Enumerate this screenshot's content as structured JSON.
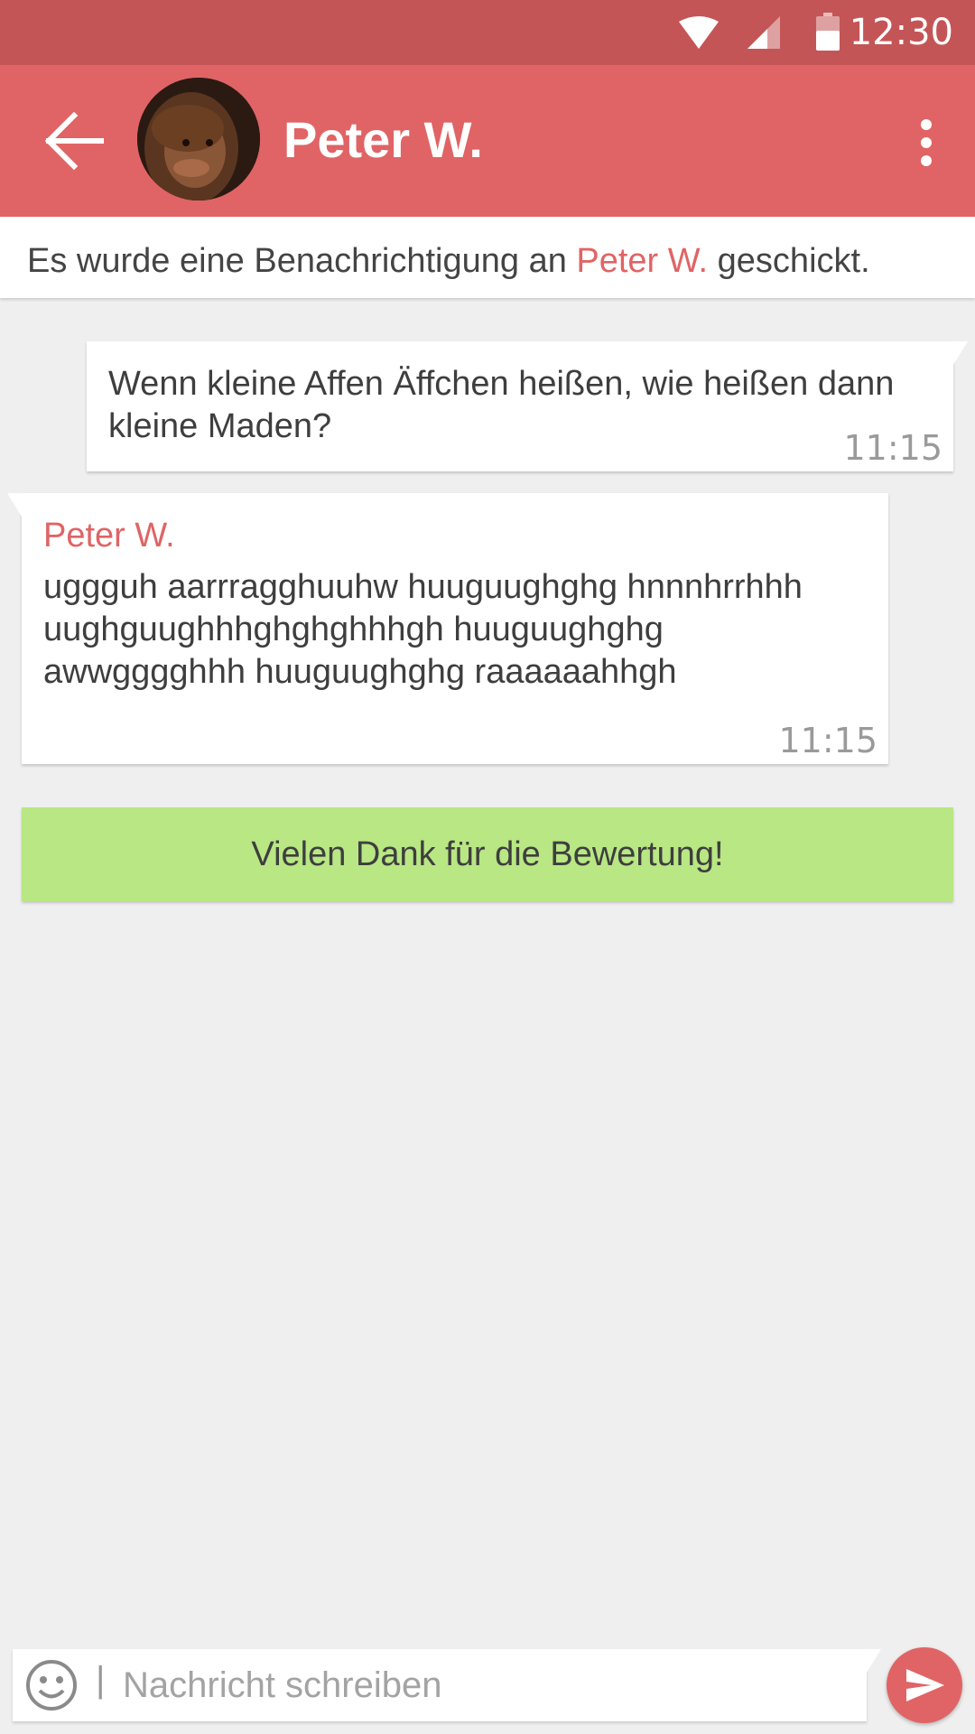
{
  "status_bar": {
    "time": "12:30",
    "icons": [
      "wifi-icon",
      "cell-signal-icon",
      "battery-icon"
    ]
  },
  "app_bar": {
    "title": "Peter W.",
    "icons": [
      "back-arrow-icon",
      "overflow-menu-icon"
    ]
  },
  "notice": {
    "prefix": "Es wurde eine Benachrichtigung an ",
    "name": "Peter W.",
    "suffix": " geschickt."
  },
  "messages": [
    {
      "direction": "outgoing",
      "text": "Wenn kleine Affen Äffchen heißen, wie heißen dann kleine Maden?",
      "time": "11:15"
    },
    {
      "direction": "incoming",
      "sender": "Peter W.",
      "text": "uggguh aarrragghuuhw huuguughghg hnnnhrrhhh uughguughhhghghghhhgh huuguughghg awwgggghhh huuguughghg raaaaaahhgh",
      "time": "11:15"
    }
  ],
  "rating_banner": {
    "text": "Vielen Dank für die Bewertung!"
  },
  "composer": {
    "placeholder": "Nachricht schreiben",
    "caret": "|",
    "value": ""
  },
  "colors": {
    "status_bar": "#c45556",
    "app_bar": "#e06465",
    "accent": "#e06465",
    "rating_banner": "#b8e783",
    "background": "#efefef"
  }
}
